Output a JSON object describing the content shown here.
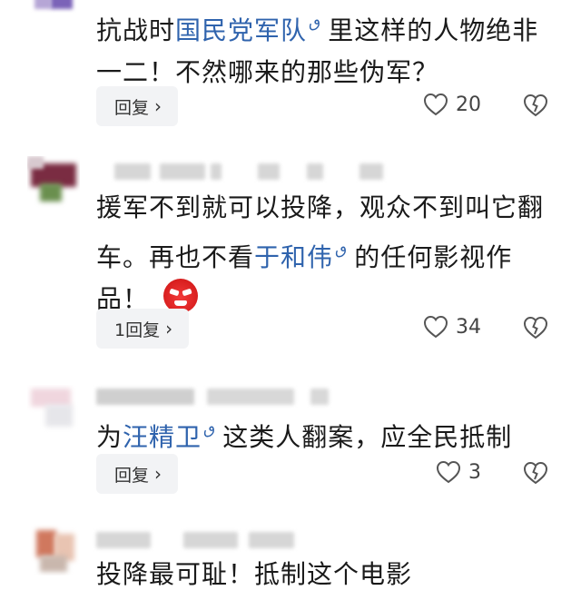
{
  "comments": [
    {
      "text_before": "抗战时",
      "link": "国民党军队",
      "text_after": "里这样的人物绝非一二！不然哪来的那些伪军？",
      "reply_label": "回复",
      "likes": "20"
    },
    {
      "text_before": "援军不到就可以投降，观众不到叫它翻车。再也不看",
      "link": "于和伟",
      "text_after": "的任何影视作品！",
      "emoji": "angry-face-emoji",
      "reply_label": "1回复",
      "likes": "34"
    },
    {
      "text_before": "为",
      "link": "汪精卫",
      "text_after": "这类人翻案，应全民抵制",
      "reply_label": "回复",
      "likes": "3"
    },
    {
      "text_before": "投降最可耻！抵制这个电影",
      "link": "",
      "text_after": ""
    }
  ],
  "icons": {
    "search_hint": "search-hint-icon",
    "like": "heart-outline-icon",
    "dislike": "broken-heart-icon",
    "chevron": "chevron-right-icon"
  },
  "colors": {
    "link": "#2f63ad",
    "reply_bg": "#f2f3f5",
    "text": "#1a1a1a"
  }
}
